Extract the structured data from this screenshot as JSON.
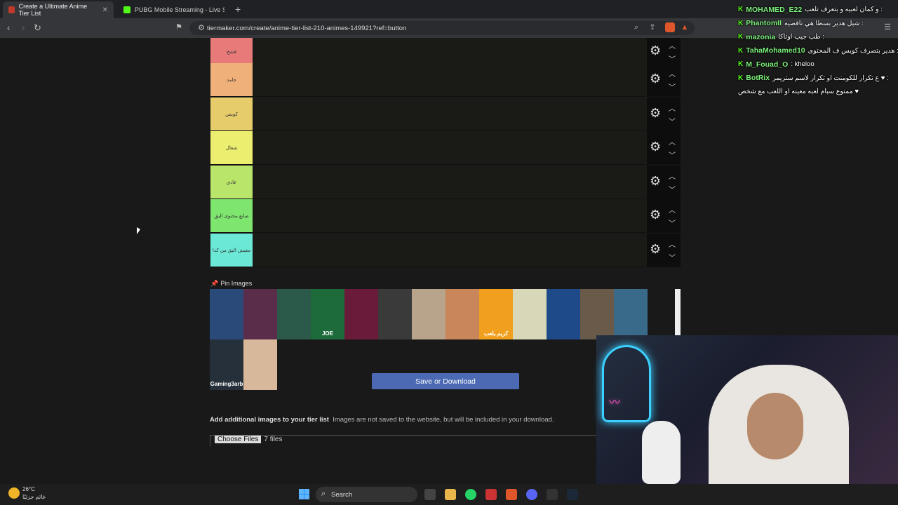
{
  "browser": {
    "tabs": [
      {
        "title": "Create a Ultimate Anime Tier List"
      },
      {
        "title": "PUBG Mobile Streaming - Live Stream"
      }
    ],
    "url": "tiermaker.com/create/anime-tier-list-210-animes-149921?ref=button"
  },
  "tiers": [
    {
      "label": "فشخ",
      "color": "#e87a7a"
    },
    {
      "label": "جامد",
      "color": "#f0b07a"
    },
    {
      "label": "كويس",
      "color": "#e7cc6c"
    },
    {
      "label": "شغال",
      "color": "#ecee6f"
    },
    {
      "label": "عادي",
      "color": "#b9e56a"
    },
    {
      "label": "صانع محتوى اليق",
      "color": "#7ee66e"
    },
    {
      "label": "مفيش اليق من كدا",
      "color": "#6ce8d6"
    }
  ],
  "pin_section": {
    "title": "Pin Images",
    "thumbs": [
      {
        "color": "#2a4b7a",
        "text": ""
      },
      {
        "color": "#5a2e4a",
        "text": ""
      },
      {
        "color": "#2b5a4a",
        "text": ""
      },
      {
        "color": "#1d6b3a",
        "text": "JOE"
      },
      {
        "color": "#6b1b3a",
        "text": ""
      },
      {
        "color": "#3a3a3a",
        "text": ""
      },
      {
        "color": "#b8a48a",
        "text": ""
      },
      {
        "color": "#c8865a",
        "text": ""
      },
      {
        "color": "#f0a01e",
        "text": "كريم يلعب"
      },
      {
        "color": "#d8d8b8",
        "text": ""
      },
      {
        "color": "#1e4a8a",
        "text": ""
      },
      {
        "color": "#6a5a4a",
        "text": ""
      },
      {
        "color": "#3a6a8a",
        "text": ""
      },
      {
        "color": "#26303a",
        "text": "Gaming3arb"
      },
      {
        "color": "#d8b89a",
        "text": ""
      }
    ]
  },
  "save_button": "Save or Download",
  "additional": {
    "bold": "Add additional images to your tier list",
    "text": "Images are not saved to the website, but will be included in your download.",
    "file_button": "Choose Files",
    "file_status": "7 files"
  },
  "chat": [
    {
      "name": "MOHAMED_E22",
      "msg": "و كمان لعبيه و بتعرف تلعب :"
    },
    {
      "name": "PhantomII",
      "msg": "شيل هدير بسطا هي ناقصيه :"
    },
    {
      "name": "mazonia",
      "msg": "طب جيب اوتاكا :"
    },
    {
      "name": "TahaMohamed10",
      "msg": "هدير بتصرف كويس ف المحتوى :"
    },
    {
      "name": "M_Fouad_O",
      "msg": ": kheloo"
    },
    {
      "name": "BotRix",
      "msg": "ع تكرار للكومنت او تكرار لاسم ستريمر ♥ :"
    },
    {
      "name": "",
      "msg": "ممنوع سبام لعبه معينه او اللعب مع شخص ♥"
    }
  ],
  "taskbar": {
    "weather_temp": "26°C",
    "weather_desc": "غائم جزئيًا",
    "search_placeholder": "Search"
  },
  "icons": {
    "gear": "gear-icon",
    "up": "chevron-up-icon",
    "down": "chevron-down-icon",
    "pin": "pin-icon"
  }
}
